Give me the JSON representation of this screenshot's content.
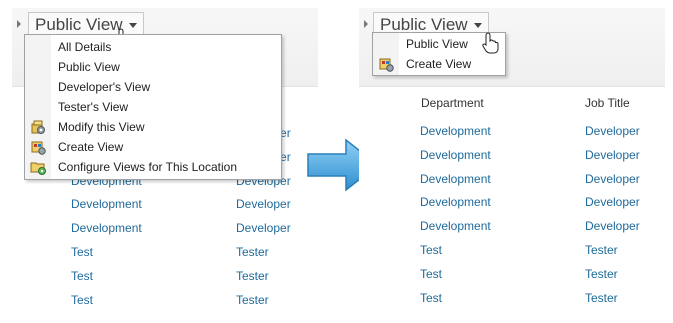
{
  "left": {
    "view_label": "Public View",
    "menu_items": [
      {
        "label": "All Details",
        "icon": ""
      },
      {
        "label": "Public View",
        "icon": ""
      },
      {
        "label": "Developer's View",
        "icon": ""
      },
      {
        "label": "Tester's View",
        "icon": ""
      },
      {
        "label": "Modify this View",
        "icon": "modify-view-icon"
      },
      {
        "label": "Create View",
        "icon": "create-view-icon"
      },
      {
        "label": "Configure Views for This Location",
        "icon": "configure-views-icon"
      }
    ],
    "column_header_job": "e",
    "rows": [
      {
        "job": "Developer"
      },
      {
        "job": "Developer"
      },
      {
        "department": "Development",
        "job": "Developer"
      },
      {
        "department": "Development",
        "job": "Developer"
      },
      {
        "department": "Development",
        "job": "Developer"
      },
      {
        "department": "Test",
        "job": "Tester"
      },
      {
        "department": "Test",
        "job": "Tester"
      },
      {
        "department": "Test",
        "job": "Tester"
      }
    ]
  },
  "right": {
    "view_label": "Public View",
    "menu_items": [
      {
        "label": "Public View",
        "icon": ""
      },
      {
        "label": "Create View",
        "icon": "create-view-icon"
      }
    ],
    "columns": [
      "Department",
      "Job Title"
    ],
    "rows": [
      {
        "department": "Development",
        "job": "Developer"
      },
      {
        "department": "Development",
        "job": "Developer"
      },
      {
        "department": "Development",
        "job": "Developer"
      },
      {
        "department": "Development",
        "job": "Developer"
      },
      {
        "department": "Development",
        "job": "Developer"
      },
      {
        "department": "Test",
        "job": "Tester"
      },
      {
        "department": "Test",
        "job": "Tester"
      },
      {
        "department": "Test",
        "job": "Tester"
      }
    ]
  },
  "colors": {
    "link": "#1f6a9a",
    "arrow": "#4aa3d9"
  }
}
